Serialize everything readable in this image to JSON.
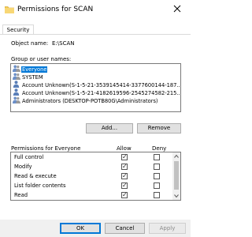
{
  "window": {
    "title": "Permissions for SCAN"
  },
  "tabs": [
    {
      "label": "Security"
    }
  ],
  "object": {
    "label": "Object name:",
    "value": "E:\\SCAN"
  },
  "groups": {
    "label": "Group or user names:",
    "items": [
      {
        "name": "Everyone",
        "selected": true
      },
      {
        "name": "SYSTEM",
        "selected": false
      },
      {
        "name": "Account Unknown(S-1-5-21-3539145414-3377600144-187...",
        "selected": false
      },
      {
        "name": "Account Unknown(S-1-5-21-4182619596-2545274582-215...",
        "selected": false
      },
      {
        "name": "Administrators (DESKTOP-POTB80G\\Administrators)",
        "selected": false
      }
    ]
  },
  "buttons": {
    "add": "Add...",
    "remove": "Remove",
    "ok": "OK",
    "cancel": "Cancel",
    "apply": "Apply"
  },
  "permissions": {
    "header": "Permissions for Everyone",
    "allow_header": "Allow",
    "deny_header": "Deny",
    "rows": [
      {
        "label": "Full control",
        "allow": true,
        "deny": false
      },
      {
        "label": "Modify",
        "allow": true,
        "deny": false
      },
      {
        "label": "Read & execute",
        "allow": true,
        "deny": false
      },
      {
        "label": "List folder contents",
        "allow": true,
        "deny": false
      },
      {
        "label": "Read",
        "allow": true,
        "deny": false
      }
    ]
  },
  "colors": {
    "accent": "#0078d7",
    "border": "#adadad",
    "button_bg": "#e1e1e1",
    "selected_bg": "#0078d7"
  },
  "icons": {
    "window": "folder-shield-icon",
    "user": "user-group-icon"
  }
}
